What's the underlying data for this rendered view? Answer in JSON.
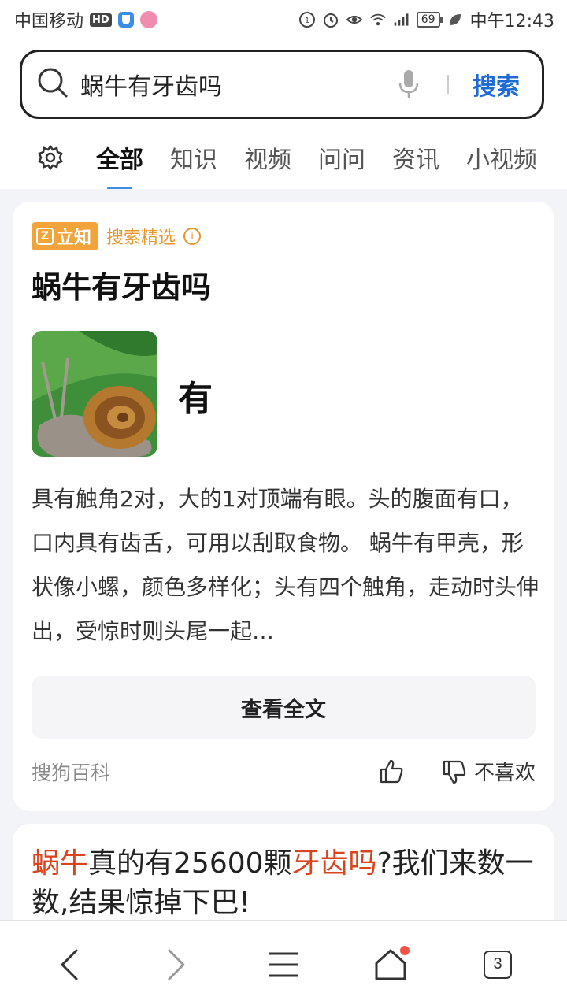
{
  "status_bar": {
    "carrier": "中国移动",
    "hd": "HD",
    "battery": "69",
    "time": "中午12:43"
  },
  "search": {
    "query": "蜗牛有牙齿吗",
    "button": "搜索"
  },
  "tabs": [
    "全部",
    "知识",
    "视频",
    "问问",
    "资讯",
    "小视频"
  ],
  "active_tab": "全部",
  "answer_card": {
    "badge": "立知",
    "badge_label": "搜索精选",
    "title": "蜗牛有牙齿吗",
    "answer": "有",
    "description": "具有触角2对，大的1对顶端有眼。头的腹面有口，口内具有齿舌，可用以刮取食物。 蜗牛有甲壳，形状像小螺，颜色多样化；头有四个触角，走动时头伸出，受惊时则头尾一起…",
    "view_all": "查看全文",
    "source": "搜狗百科",
    "dislike": "不喜欢"
  },
  "result_2": {
    "part1": "蜗牛",
    "part2": "真的有25600颗",
    "part3": "牙齿吗",
    "part4": "?我们来数一数,结果惊掉下巴!"
  },
  "bottom_nav": {
    "tab_count": "3"
  },
  "colors": {
    "accent_blue": "#1f6bd6",
    "badge_orange": "#f2a43a",
    "highlight_red": "#d9431e"
  }
}
